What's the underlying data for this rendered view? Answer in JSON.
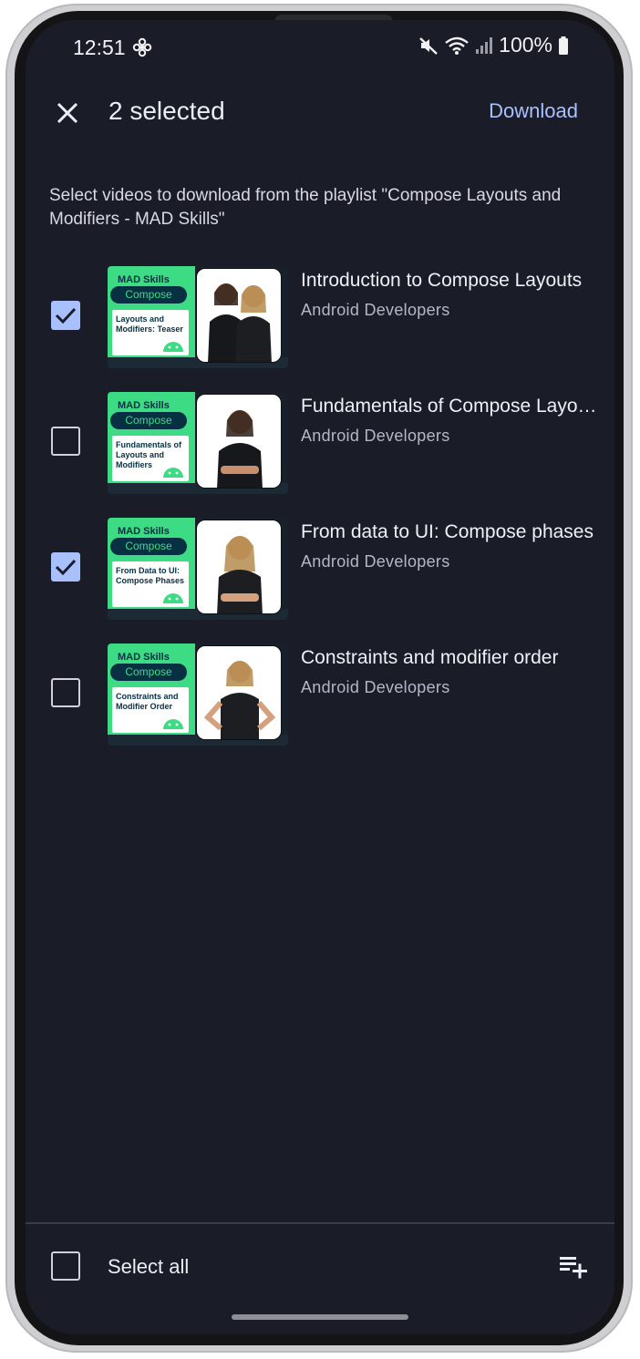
{
  "status_bar": {
    "time": "12:51",
    "battery": "100%"
  },
  "app_bar": {
    "title": "2 selected",
    "action": "Download"
  },
  "description": "Select videos to download from the playlist \"Compose Layouts and Modifiers - MAD Skills\"",
  "videos": [
    {
      "title": "Introduction to Compose Layouts",
      "channel": "Android Developers",
      "checked": true,
      "thumb": {
        "brand": "MAD Skills",
        "series": "Compose",
        "caption": "Layouts and Modifiers: Teaser"
      }
    },
    {
      "title": "Fundamentals of Compose Layouts",
      "channel": "Android Developers",
      "checked": false,
      "thumb": {
        "brand": "MAD Skills",
        "series": "Compose",
        "caption": "Fundamentals of Layouts and Modifiers"
      }
    },
    {
      "title": "From data to UI: Compose phases",
      "channel": "Android Developers",
      "checked": true,
      "thumb": {
        "brand": "MAD Skills",
        "series": "Compose",
        "caption": "From Data to UI: Compose Phases"
      }
    },
    {
      "title": "Constraints and modifier order",
      "channel": "Android Developers",
      "checked": false,
      "thumb": {
        "brand": "MAD Skills",
        "series": "Compose",
        "caption": "Constraints and Modifier Order"
      }
    }
  ],
  "bottom_bar": {
    "select_all": "Select all"
  },
  "colors": {
    "background": "#1a1c27",
    "accent": "#a9c0ff",
    "thumb_green": "#3ddc84",
    "thumb_navy": "#073042"
  },
  "icons": [
    "fan-icon",
    "mute-icon",
    "wifi-icon",
    "signal-icon",
    "battery-icon",
    "close-icon",
    "checkmark-icon",
    "playlist-add-icon",
    "android-icon"
  ]
}
